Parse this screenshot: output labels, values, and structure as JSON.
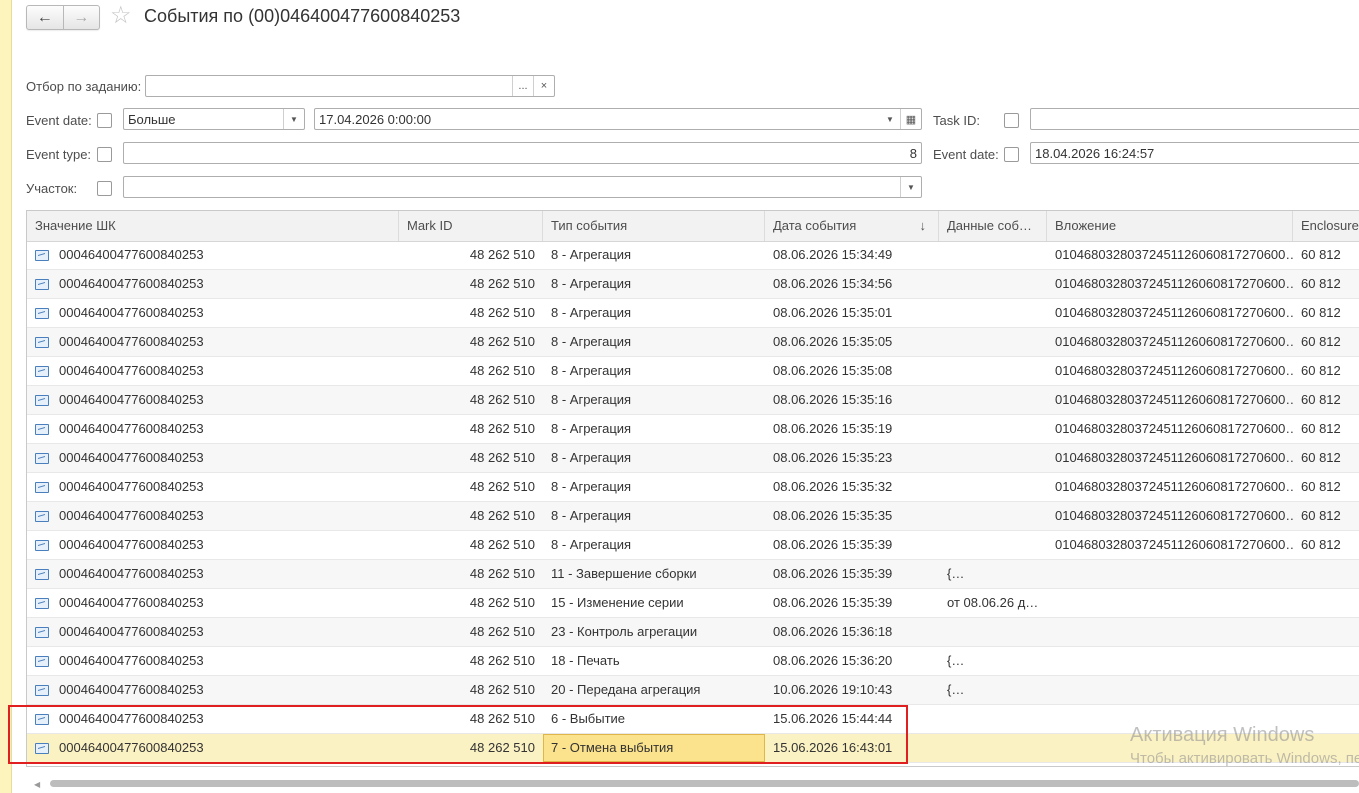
{
  "window": {
    "title": "События по (00)046400477600840253",
    "back_icon": "←",
    "forward_icon": "→",
    "favorite_icon": "☆"
  },
  "filters": {
    "task_filter": {
      "label": "Отбор по заданию:",
      "value": "",
      "select_btn": "...",
      "clear_btn": "×"
    },
    "event_date": {
      "label": "Event date:",
      "operator": "Больше",
      "value": "17.04.2026  0:00:00"
    },
    "event_type": {
      "label": "Event type:",
      "value": "8"
    },
    "area": {
      "label": "Участок:",
      "value": ""
    },
    "task_id": {
      "label": "Task ID:",
      "value": ""
    },
    "event_date2": {
      "label": "Event date:",
      "value": "18.04.2026 16:24:57"
    }
  },
  "table": {
    "columns": [
      "Значение ШК",
      "Mark ID",
      "Тип события",
      "Дата события",
      "Данные соб…",
      "Вложение",
      "Enclosure"
    ],
    "sort_icon": "↓",
    "rows": [
      {
        "code": "00046400477600840253",
        "mark": "48 262 510",
        "type": "8 - Агрегация",
        "date": "08.06.2026 15:34:49",
        "data": "",
        "attach": "01046803280372451126060817270600…",
        "encl": "60 812"
      },
      {
        "code": "00046400477600840253",
        "mark": "48 262 510",
        "type": "8 - Агрегация",
        "date": "08.06.2026 15:34:56",
        "data": "",
        "attach": "01046803280372451126060817270600…",
        "encl": "60 812"
      },
      {
        "code": "00046400477600840253",
        "mark": "48 262 510",
        "type": "8 - Агрегация",
        "date": "08.06.2026 15:35:01",
        "data": "",
        "attach": "01046803280372451126060817270600…",
        "encl": "60 812"
      },
      {
        "code": "00046400477600840253",
        "mark": "48 262 510",
        "type": "8 - Агрегация",
        "date": "08.06.2026 15:35:05",
        "data": "",
        "attach": "01046803280372451126060817270600…",
        "encl": "60 812"
      },
      {
        "code": "00046400477600840253",
        "mark": "48 262 510",
        "type": "8 - Агрегация",
        "date": "08.06.2026 15:35:08",
        "data": "",
        "attach": "01046803280372451126060817270600…",
        "encl": "60 812"
      },
      {
        "code": "00046400477600840253",
        "mark": "48 262 510",
        "type": "8 - Агрегация",
        "date": "08.06.2026 15:35:16",
        "data": "",
        "attach": "01046803280372451126060817270600…",
        "encl": "60 812"
      },
      {
        "code": "00046400477600840253",
        "mark": "48 262 510",
        "type": "8 - Агрегация",
        "date": "08.06.2026 15:35:19",
        "data": "",
        "attach": "01046803280372451126060817270600…",
        "encl": "60 812"
      },
      {
        "code": "00046400477600840253",
        "mark": "48 262 510",
        "type": "8 - Агрегация",
        "date": "08.06.2026 15:35:23",
        "data": "",
        "attach": "01046803280372451126060817270600…",
        "encl": "60 812"
      },
      {
        "code": "00046400477600840253",
        "mark": "48 262 510",
        "type": "8 - Агрегация",
        "date": "08.06.2026 15:35:32",
        "data": "",
        "attach": "01046803280372451126060817270600…",
        "encl": "60 812"
      },
      {
        "code": "00046400477600840253",
        "mark": "48 262 510",
        "type": "8 - Агрегация",
        "date": "08.06.2026 15:35:35",
        "data": "",
        "attach": "01046803280372451126060817270600…",
        "encl": "60 812"
      },
      {
        "code": "00046400477600840253",
        "mark": "48 262 510",
        "type": "8 - Агрегация",
        "date": "08.06.2026 15:35:39",
        "data": "",
        "attach": "01046803280372451126060817270600…",
        "encl": "60 812"
      },
      {
        "code": "00046400477600840253",
        "mark": "48 262 510",
        "type": "11 - Завершение сборки",
        "date": "08.06.2026 15:35:39",
        "data": "{…",
        "attach": "",
        "encl": ""
      },
      {
        "code": "00046400477600840253",
        "mark": "48 262 510",
        "type": "15 - Изменение серии",
        "date": "08.06.2026 15:35:39",
        "data": "от 08.06.26 д…",
        "attach": "",
        "encl": ""
      },
      {
        "code": "00046400477600840253",
        "mark": "48 262 510",
        "type": "23 - Контроль агрегации",
        "date": "08.06.2026 15:36:18",
        "data": "",
        "attach": "",
        "encl": ""
      },
      {
        "code": "00046400477600840253",
        "mark": "48 262 510",
        "type": "18 - Печать",
        "date": "08.06.2026 15:36:20",
        "data": "{…",
        "attach": "",
        "encl": ""
      },
      {
        "code": "00046400477600840253",
        "mark": "48 262 510",
        "type": "20 - Передана агрегация",
        "date": "10.06.2026 19:10:43",
        "data": "{…",
        "attach": "",
        "encl": ""
      },
      {
        "code": "00046400477600840253",
        "mark": "48 262 510",
        "type": "6 - Выбытие",
        "date": "15.06.2026 15:44:44",
        "data": "",
        "attach": "",
        "encl": ""
      },
      {
        "code": "00046400477600840253",
        "mark": "48 262 510",
        "type": "7 - Отмена выбытия",
        "date": "15.06.2026 16:43:01",
        "data": "",
        "attach": "",
        "encl": ""
      }
    ],
    "selected_row": 17
  },
  "watermark": {
    "line1": "Активация Windows",
    "line2": "Чтобы активировать Windows, пе"
  },
  "colors": {
    "selected_row": "#fbf2c4",
    "focused_cell": "#fbe28d",
    "highlight_box": "#e02020"
  }
}
